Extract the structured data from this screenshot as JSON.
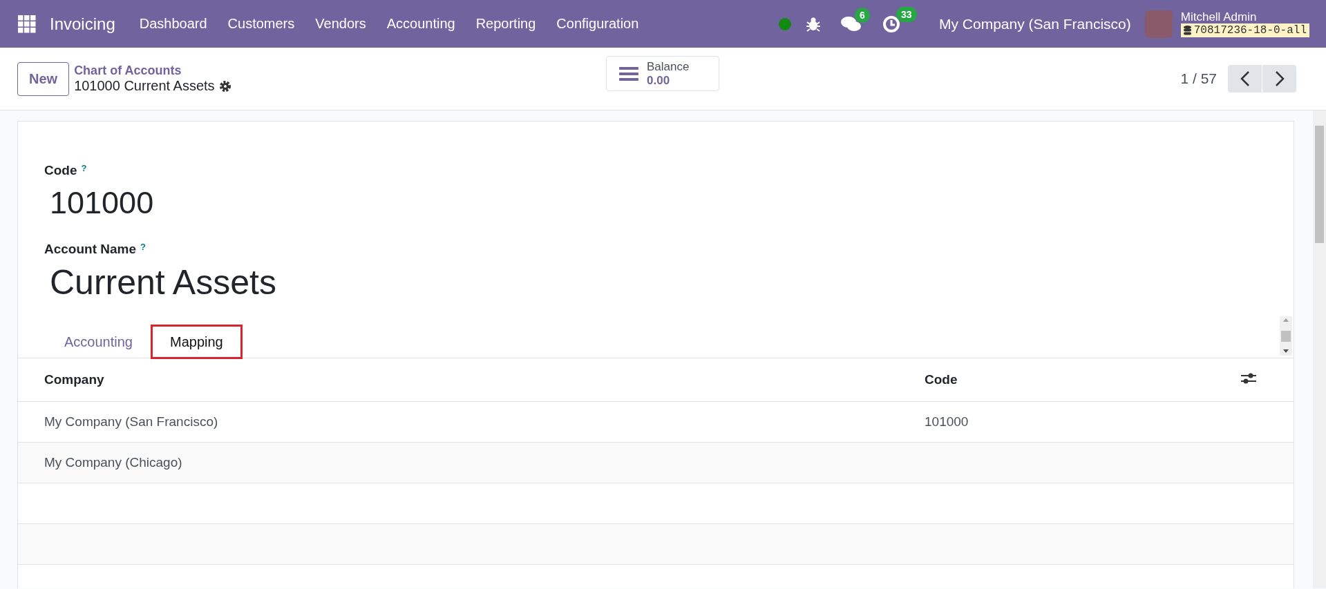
{
  "navbar": {
    "app_name": "Invoicing",
    "menu": [
      "Dashboard",
      "Customers",
      "Vendors",
      "Accounting",
      "Reporting",
      "Configuration"
    ],
    "chat_count": "6",
    "activity_count": "33",
    "company": "My Company (San Francisco)",
    "user_name": "Mitchell Admin",
    "database": "70817236-18-0-all"
  },
  "control_panel": {
    "new_button": "New",
    "breadcrumb": "Chart of Accounts",
    "record_title": "101000 Current Assets",
    "balance_label": "Balance",
    "balance_value": "0.00",
    "pager": "1 / 57"
  },
  "form": {
    "fields": [
      {
        "kind": "code",
        "label": "Code",
        "help": "?",
        "value": "101000"
      },
      {
        "kind": "name",
        "label": "Account Name",
        "help": "?",
        "value": "Current Assets"
      }
    ]
  },
  "tabs": [
    {
      "label": "Accounting",
      "selected": false,
      "highlighted": false
    },
    {
      "label": "Mapping",
      "selected": true,
      "highlighted": true
    }
  ],
  "table": {
    "columns": [
      "Company",
      "Code"
    ],
    "rows": [
      {
        "company": "My Company (San Francisco)",
        "code": "101000"
      },
      {
        "company": "My Company (Chicago)"
      }
    ]
  }
}
